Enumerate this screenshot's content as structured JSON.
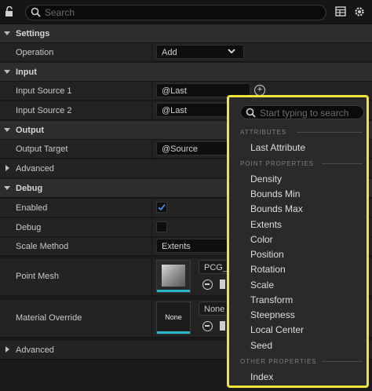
{
  "toolbar": {
    "search_placeholder": "Search"
  },
  "sections": {
    "settings": "Settings",
    "input": "Input",
    "output": "Output",
    "debug": "Debug"
  },
  "rows": {
    "operation": {
      "label": "Operation",
      "value": "Add"
    },
    "input_source_1": {
      "label": "Input Source 1",
      "value": "@Last"
    },
    "input_source_2": {
      "label": "Input Source 2",
      "value": "@Last"
    },
    "output_target": {
      "label": "Output Target",
      "value": "@Source"
    },
    "advanced_output": {
      "label": "Advanced"
    },
    "enabled": {
      "label": "Enabled",
      "checked": true
    },
    "debug": {
      "label": "Debug",
      "checked": false
    },
    "scale_method": {
      "label": "Scale Method",
      "value": "Extents"
    },
    "point_mesh": {
      "label": "Point Mesh",
      "asset": "PCG_C"
    },
    "material_override": {
      "label": "Material Override",
      "asset": "None",
      "thumb_text": "None"
    },
    "advanced_debug": {
      "label": "Advanced"
    }
  },
  "popup": {
    "search_placeholder": "Start typing to search",
    "categories": {
      "attributes": "ATTRIBUTES",
      "point_properties": "POINT PROPERTIES",
      "other_properties": "OTHER PROPERTIES"
    },
    "attributes": [
      "Last Attribute"
    ],
    "point_properties": [
      "Density",
      "Bounds Min",
      "Bounds Max",
      "Extents",
      "Color",
      "Position",
      "Rotation",
      "Scale",
      "Transform",
      "Steepness",
      "Local Center",
      "Seed"
    ],
    "other_properties": [
      "Index"
    ]
  },
  "colors": {
    "highlight_border": "#f2e33a",
    "checkbox_accent": "#2f8ff0",
    "thumbnail_bar": "#2ab6c8"
  }
}
